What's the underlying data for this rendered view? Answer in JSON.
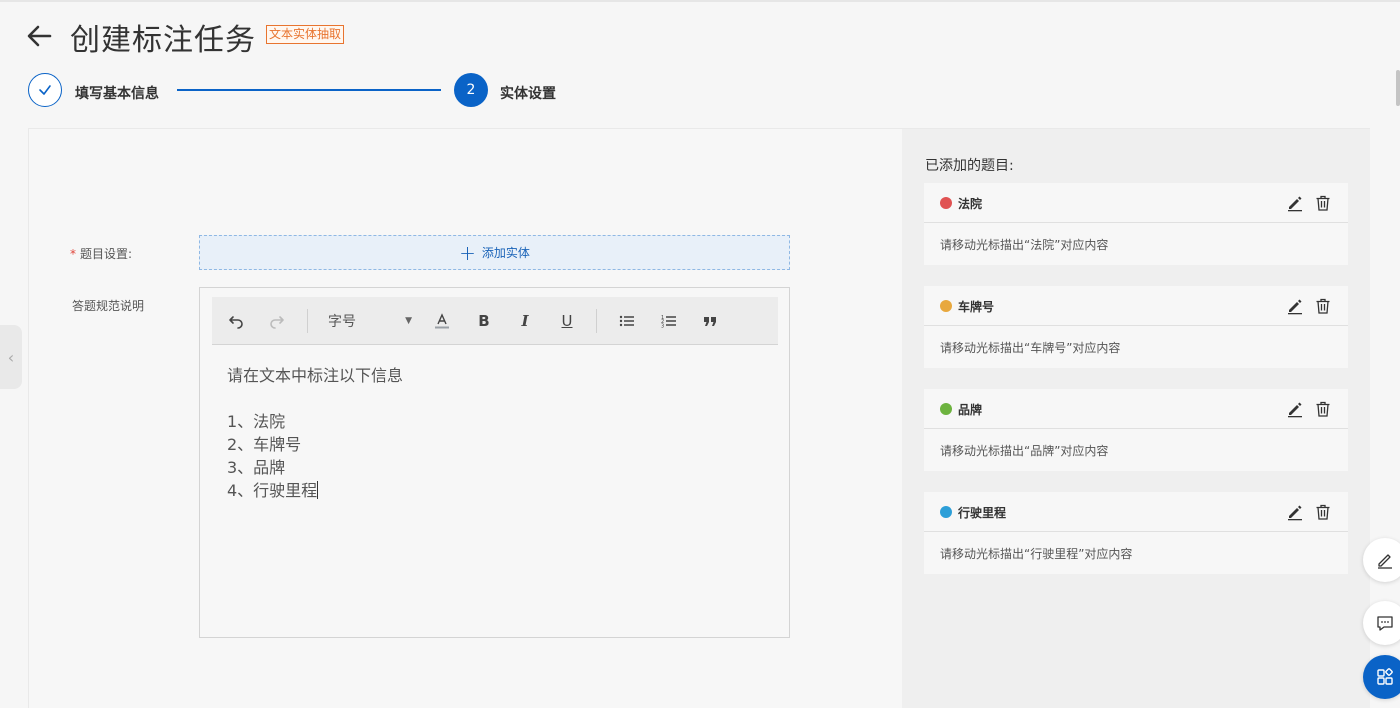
{
  "header": {
    "title": "创建标注任务",
    "tag": "文本实体抽取"
  },
  "steps": [
    {
      "label": "填写基本信息",
      "status": "done"
    },
    {
      "number": "2",
      "label": "实体设置",
      "status": "active"
    }
  ],
  "form": {
    "entity_label": "题目设置:",
    "required_mark": "*",
    "add_entity_label": "添加实体",
    "guide_label": "答题规范说明"
  },
  "editor": {
    "fontsize_label": "字号",
    "lines": [
      "请在文本中标注以下信息",
      "",
      "1、法院",
      "2、车牌号",
      "3、品牌",
      "4、行驶里程"
    ]
  },
  "added_panel": {
    "title": "已添加的题目:",
    "entities": [
      {
        "name": "法院",
        "color": "#e05252",
        "desc": "请移动光标描出“法院”对应内容"
      },
      {
        "name": "车牌号",
        "color": "#e8a83e",
        "desc": "请移动光标描出“车牌号”对应内容"
      },
      {
        "name": "品牌",
        "color": "#6db33f",
        "desc": "请移动光标描出“品牌”对应内容"
      },
      {
        "name": "行驶里程",
        "color": "#2d9fd8",
        "desc": "请移动光标描出“行驶里程”对应内容"
      }
    ]
  },
  "colors": {
    "primary": "#0a63c7",
    "tag": "#e8742f"
  }
}
